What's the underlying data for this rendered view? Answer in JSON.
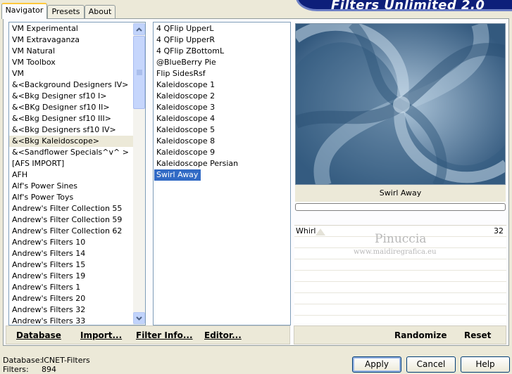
{
  "tabs": [
    {
      "label": "Navigator",
      "active": true
    },
    {
      "label": "Presets",
      "active": false
    },
    {
      "label": "About",
      "active": false
    }
  ],
  "banner": {
    "title": "Filters Unlimited 2.0",
    "color": "#0d1f7a"
  },
  "categories": [
    "VM Experimental",
    "VM Extravaganza",
    "VM Natural",
    "VM Toolbox",
    "VM",
    "&<Background Designers IV>",
    "&<Bkg Designer sf10 I>",
    "&<BKg Designer sf10 II>",
    "&<Bkg Designer sf10 III>",
    "&<Bkg Designers sf10 IV>",
    "&<Bkg Kaleidoscope>",
    "&<Sandflower Specials^v^ >",
    "[AFS IMPORT]",
    "AFH",
    "Alf's Power Sines",
    "Alf's Power Toys",
    "Andrew's Filter Collection 55",
    "Andrew's Filter Collection 59",
    "Andrew's Filter Collection 62",
    "Andrew's Filters 10",
    "Andrew's Filters 14",
    "Andrew's Filters 15",
    "Andrew's Filters 19",
    "Andrew's Filters 1",
    "Andrew's Filters 20",
    "Andrew's Filters 32",
    "Andrew's Filters 33"
  ],
  "selected_category_index": 10,
  "filters": [
    "4 QFlip UpperL",
    "4 QFlip UpperR",
    "4 QFlip ZBottomL",
    "@BlueBerry Pie",
    "Flip SidesRsf",
    "Kaleidoscope 1",
    "Kaleidoscope 2",
    "Kaleidoscope 3",
    "Kaleidoscope 4",
    "Kaleidoscope 5",
    "Kaleidoscope 8",
    "Kaleidoscope 9",
    "Kaleidoscope Persian",
    "Swirl Away"
  ],
  "selected_filter_index": 13,
  "preview": {
    "filter_name": "Swirl Away"
  },
  "sliders": [
    {
      "label": "Whirl",
      "value": "32"
    }
  ],
  "watermark": {
    "name": "Pinuccia",
    "site": "www.maidiregrafica.eu"
  },
  "linkbar": {
    "database": "Database",
    "import": "Import...",
    "filter_info": "Filter Info...",
    "editor": "Editor...",
    "randomize": "Randomize",
    "reset": "Reset"
  },
  "status": {
    "database_label": "Database:",
    "database_value": "ICNET-Filters",
    "filters_label": "Filters:",
    "filters_value": "894"
  },
  "buttons": {
    "apply": "Apply",
    "cancel": "Cancel",
    "help": "Help"
  }
}
